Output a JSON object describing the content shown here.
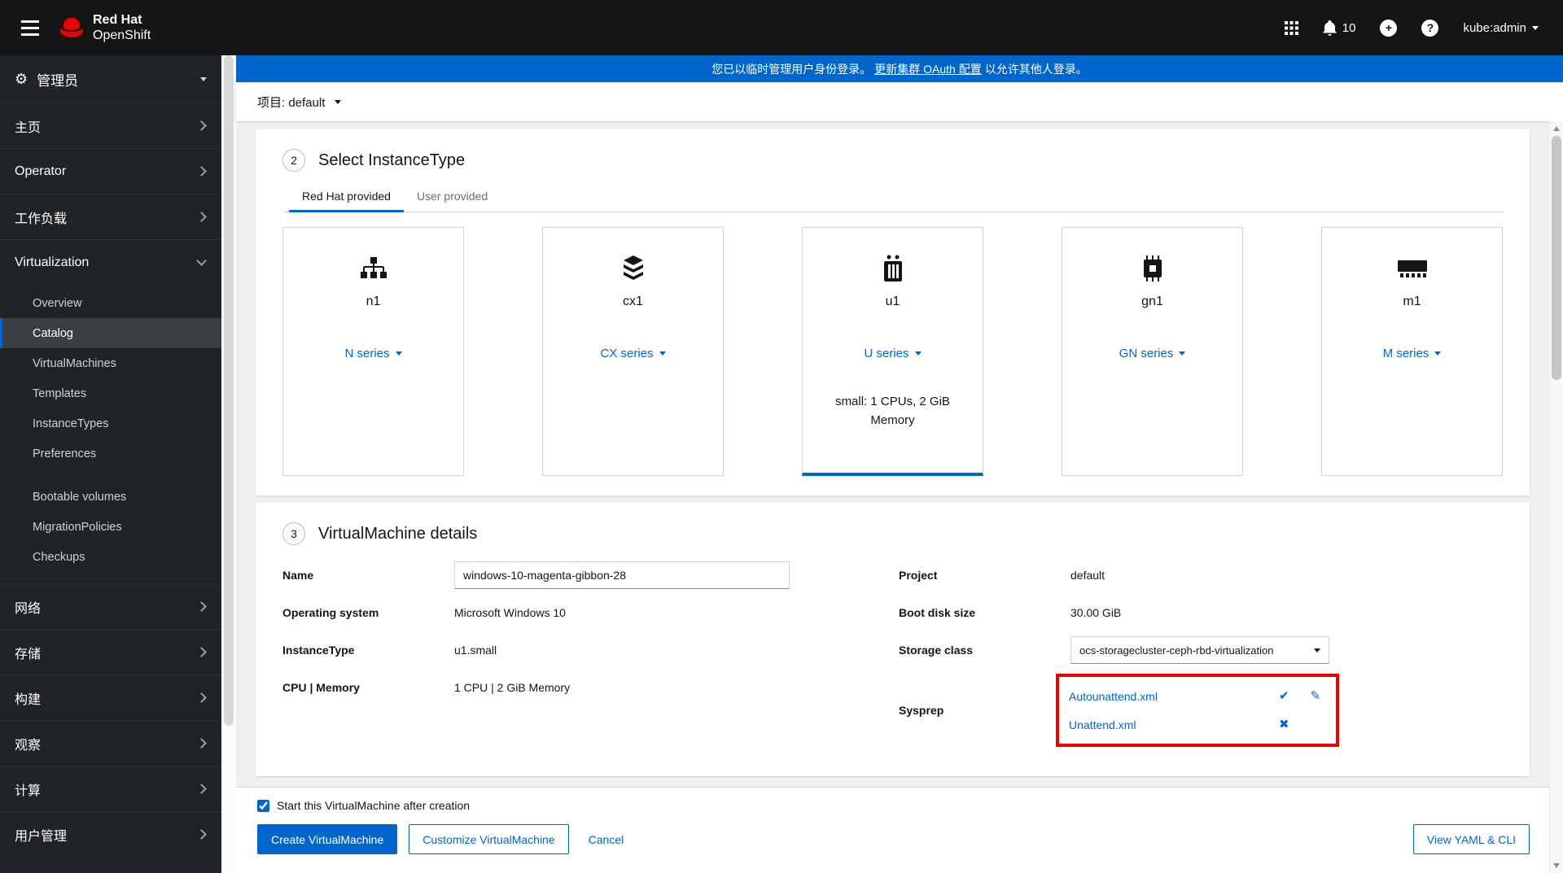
{
  "masthead": {
    "brand_top": "Red Hat",
    "brand_bottom": "OpenShift",
    "notification_count": "10",
    "user_menu": "kube:admin"
  },
  "banner": {
    "prefix": "您已以临时管理用户身份登录。",
    "link": "更新集群 OAuth 配置",
    "suffix": "以允许其他人登录。"
  },
  "project_bar": {
    "label": "项目: default"
  },
  "sidebar": {
    "perspective": "管理员",
    "items": [
      {
        "label": "主页"
      },
      {
        "label": "Operator"
      },
      {
        "label": "工作负载"
      },
      {
        "label": "Virtualization"
      },
      {
        "label": "网络"
      },
      {
        "label": "存储"
      },
      {
        "label": "构建"
      },
      {
        "label": "观察"
      },
      {
        "label": "计算"
      },
      {
        "label": "用户管理"
      }
    ],
    "virtualization_children": [
      {
        "label": "Overview"
      },
      {
        "label": "Catalog"
      },
      {
        "label": "VirtualMachines"
      },
      {
        "label": "Templates"
      },
      {
        "label": "InstanceTypes"
      },
      {
        "label": "Preferences"
      }
    ],
    "virtualization_children_secondary": [
      {
        "label": "Bootable volumes"
      },
      {
        "label": "MigrationPolicies"
      },
      {
        "label": "Checkups"
      }
    ]
  },
  "instancetype_section": {
    "step": "2",
    "title": "Select InstanceType",
    "tab_redhat": "Red Hat provided",
    "tab_user": "User provided",
    "cards": [
      {
        "name": "n1",
        "series": "N series"
      },
      {
        "name": "cx1",
        "series": "CX series"
      },
      {
        "name": "u1",
        "series": "U series",
        "detail": "small: 1 CPUs, 2 GiB Memory"
      },
      {
        "name": "gn1",
        "series": "GN series"
      },
      {
        "name": "m1",
        "series": "M series"
      }
    ]
  },
  "details_section": {
    "step": "3",
    "title": "VirtualMachine details",
    "name_label": "Name",
    "name_value": "windows-10-magenta-gibbon-28",
    "os_label": "Operating system",
    "os_value": "Microsoft Windows 10",
    "instancetype_label": "InstanceType",
    "instancetype_value": "u1.small",
    "cpu_label": "CPU | Memory",
    "cpu_value": "1 CPU | 2 GiB Memory",
    "project_label": "Project",
    "project_value": "default",
    "bootdisk_label": "Boot disk size",
    "bootdisk_value": "30.00 GiB",
    "storageclass_label": "Storage class",
    "storageclass_value": "ocs-storagecluster-ceph-rbd-virtualization",
    "sysprep_label": "Sysprep",
    "sysprep_file1": "Autounattend.xml",
    "sysprep_file2": "Unattend.xml"
  },
  "footer": {
    "checkbox_label": "Start this VirtualMachine after creation",
    "checkbox_checked": true,
    "create_label": "Create VirtualMachine",
    "customize_label": "Customize VirtualMachine",
    "cancel_label": "Cancel",
    "view_yaml_label": "View YAML & CLI"
  },
  "colors": {
    "accent": "#0066cc",
    "banner": "#0066cc",
    "annotation_red": "#ee0000"
  }
}
